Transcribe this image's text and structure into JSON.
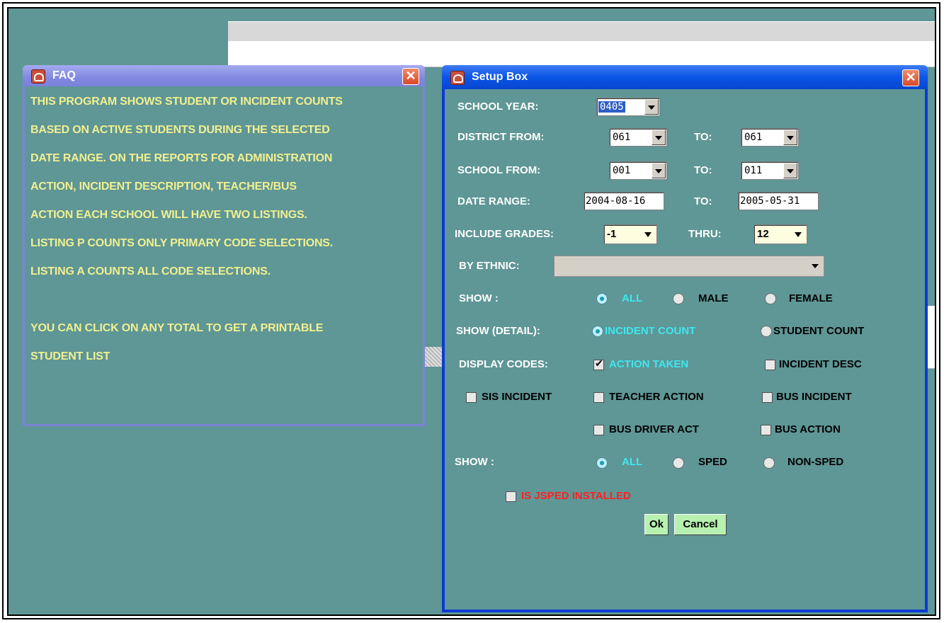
{
  "faq": {
    "title": "FAQ",
    "lines": [
      "THIS PROGRAM SHOWS STUDENT OR INCIDENT COUNTS",
      "BASED ON ACTIVE STUDENTS DURING THE SELECTED",
      "DATE RANGE.  ON THE REPORTS FOR ADMINISTRATION",
      "ACTION, INCIDENT DESCRIPTION, TEACHER/BUS",
      "ACTION EACH SCHOOL WILL HAVE TWO LISTINGS.",
      "LISTING P COUNTS ONLY PRIMARY CODE SELECTIONS.",
      "LISTING A COUNTS ALL CODE SELECTIONS.",
      "",
      "YOU CAN CLICK ON ANY TOTAL TO GET A PRINTABLE",
      "STUDENT LIST"
    ],
    "close_label": "✕"
  },
  "setup": {
    "title": "Setup Box",
    "close_label": "✕",
    "school_year": {
      "label": "SCHOOL YEAR:",
      "value": "0405"
    },
    "district": {
      "label": "DISTRICT FROM:",
      "from": "061",
      "to_label": "TO:",
      "to": "061"
    },
    "school": {
      "label": "SCHOOL FROM:",
      "from": "001",
      "to_label": "TO:",
      "to": "011"
    },
    "date_range": {
      "label": "DATE RANGE:",
      "from": "2004-08-16",
      "to_label": "TO:",
      "to": "2005-05-31"
    },
    "grades": {
      "label": "INCLUDE GRADES:",
      "from": "-1",
      "thru_label": "THRU:",
      "to": "12"
    },
    "ethnic": {
      "label": "BY ETHNIC:",
      "value": ""
    },
    "show_gender": {
      "label": "SHOW :",
      "options": [
        "ALL",
        "MALE",
        "FEMALE"
      ],
      "selected": "ALL"
    },
    "show_detail": {
      "label": "SHOW (DETAIL):",
      "options": [
        "INCIDENT COUNT",
        "STUDENT COUNT"
      ],
      "selected": "INCIDENT COUNT"
    },
    "display_codes": {
      "label": "DISPLAY CODES:",
      "action_taken": "ACTION TAKEN",
      "incident_desc": "INCIDENT DESC",
      "sis_incident": "SIS INCIDENT",
      "teacher_action": "TEACHER ACTION",
      "bus_incident": "BUS INCIDENT",
      "bus_driver_act": "BUS DRIVER ACT",
      "bus_action": "BUS ACTION"
    },
    "show_sped": {
      "label": "SHOW :",
      "options": [
        "ALL",
        "SPED",
        "NON-SPED"
      ],
      "selected": "ALL"
    },
    "jsped": {
      "label": "IS JSPED INSTALLED",
      "checked": false
    },
    "ok_label": "Ok",
    "cancel_label": "Cancel"
  }
}
